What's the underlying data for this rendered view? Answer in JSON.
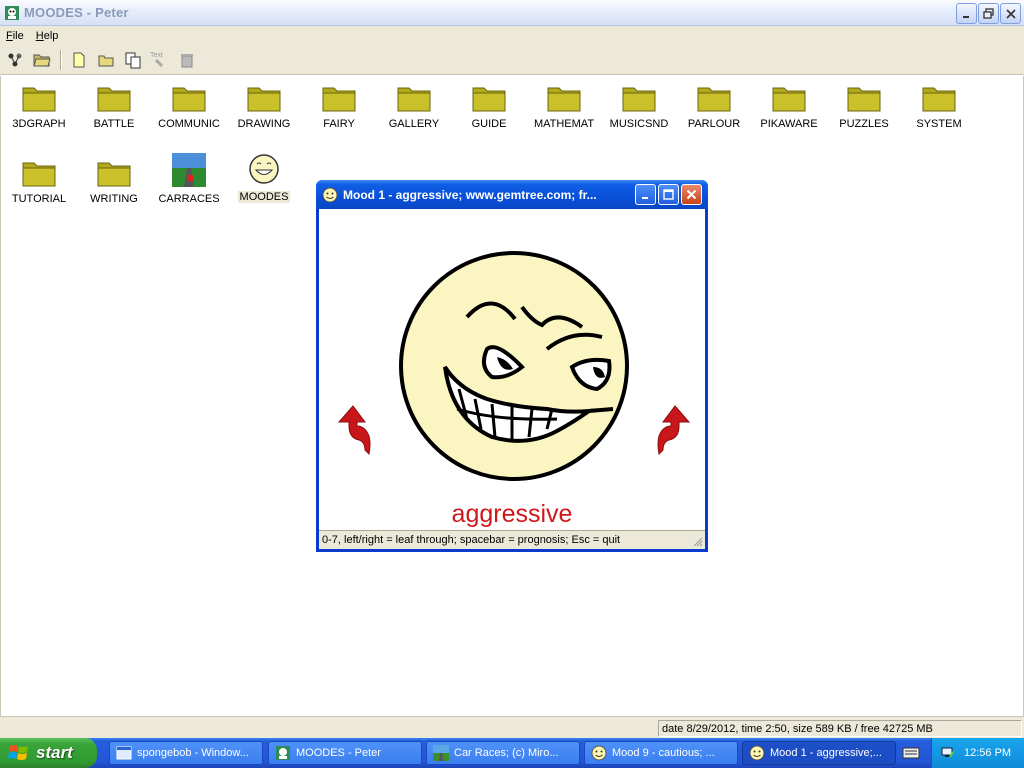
{
  "main_window": {
    "title": "MOODES - Peter",
    "menu": [
      "File",
      "Help"
    ]
  },
  "toolbar": {
    "text_tool_label": "Text"
  },
  "desktop_items": [
    {
      "label": "3DGRAPH",
      "icon": "folder-icon"
    },
    {
      "label": "BATTLE",
      "icon": "folder-icon"
    },
    {
      "label": "COMMUNIC",
      "icon": "folder-icon"
    },
    {
      "label": "DRAWING",
      "icon": "folder-icon"
    },
    {
      "label": "FAIRY",
      "icon": "folder-icon"
    },
    {
      "label": "GALLERY",
      "icon": "folder-icon"
    },
    {
      "label": "GUIDE",
      "icon": "folder-icon"
    },
    {
      "label": "MATHEMAT",
      "icon": "folder-icon"
    },
    {
      "label": "MUSICSND",
      "icon": "folder-icon"
    },
    {
      "label": "PARLOUR",
      "icon": "folder-icon"
    },
    {
      "label": "PIKAWARE",
      "icon": "folder-icon"
    },
    {
      "label": "PUZZLES",
      "icon": "folder-icon"
    },
    {
      "label": "SYSTEM",
      "icon": "folder-icon"
    },
    {
      "label": "TUTORIAL",
      "icon": "folder-icon"
    },
    {
      "label": "WRITING",
      "icon": "folder-icon"
    },
    {
      "label": "CARRACES",
      "icon": "car-race-icon"
    },
    {
      "label": "MOODES",
      "icon": "smiley-icon",
      "selected": true
    }
  ],
  "mood_window": {
    "title": "Mood 1 - aggressive;  www.gemtree.com;  fr...",
    "mood_label": "aggressive",
    "status": "0-7, left/right = leaf through;     spacebar = prognosis;     Esc = quit",
    "label_color": "#d0181c"
  },
  "status_bar": {
    "info": "date 8/29/2012, time 2:50, size 589 KB / free 42725 MB"
  },
  "taskbar": {
    "start_label": "start",
    "tasks": [
      {
        "label": "spongebob - Window...",
        "icon": "window-icon"
      },
      {
        "label": "MOODES - Peter",
        "icon": "peter-icon"
      },
      {
        "label": "Car Races;  (c) Miro...",
        "icon": "car-race-icon"
      },
      {
        "label": "Mood 9 - cautious;  ...",
        "icon": "smiley-icon"
      },
      {
        "label": "Mood 1 - aggressive;...",
        "icon": "smiley-icon",
        "active": true
      }
    ],
    "clock": "12:56 PM"
  }
}
